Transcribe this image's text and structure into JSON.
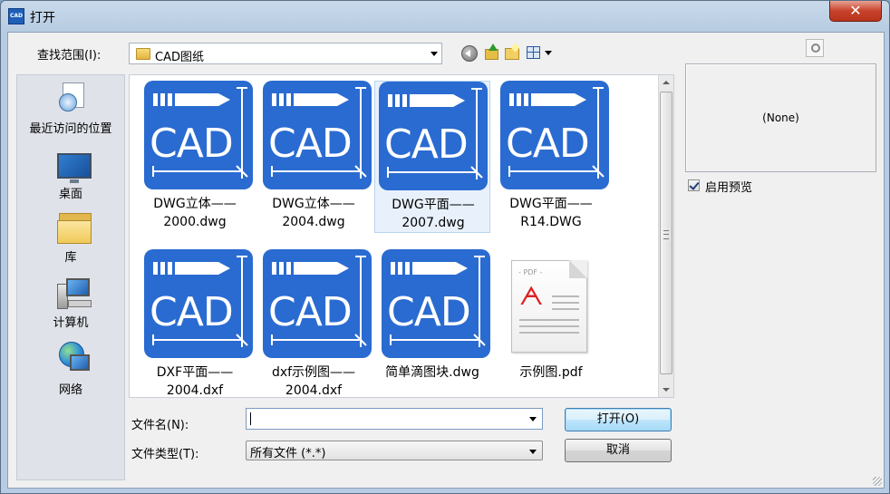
{
  "window": {
    "title": "打开",
    "app_icon_text": "CAD",
    "close_glyph": "✕"
  },
  "lookin": {
    "label": "查找范围(I):",
    "value": "CAD图纸"
  },
  "toolbar": {
    "icons": [
      "back-icon",
      "up-folder-icon",
      "new-folder-icon",
      "view-menu-icon"
    ]
  },
  "places": [
    {
      "label": "最近访问的位置",
      "icon": "recent-places-icon"
    },
    {
      "label": "桌面",
      "icon": "desktop-icon"
    },
    {
      "label": "库",
      "icon": "libraries-icon"
    },
    {
      "label": "计算机",
      "icon": "computer-icon"
    },
    {
      "label": "网络",
      "icon": "network-icon"
    }
  ],
  "files": [
    {
      "line1": "DWG立体——",
      "line2": "2000.dwg",
      "icon_text": "CAD",
      "type": "cad"
    },
    {
      "line1": "DWG立体——",
      "line2": "2004.dwg",
      "icon_text": "CAD",
      "type": "cad"
    },
    {
      "line1": "DWG平面——",
      "line2": "2007.dwg",
      "icon_text": "CAD",
      "type": "cad",
      "selected": true
    },
    {
      "line1": "DWG平面——",
      "line2": "R14.DWG",
      "icon_text": "CAD",
      "type": "cad"
    },
    {
      "line1": "DXF平面——",
      "line2": "2004.dxf",
      "icon_text": "CAD",
      "type": "cad"
    },
    {
      "line1": "dxf示例图——",
      "line2": "2004.dxf",
      "icon_text": "CAD",
      "type": "cad"
    },
    {
      "line1": "简单滴图块.dwg",
      "line2": "",
      "icon_text": "CAD",
      "type": "cad"
    },
    {
      "line1": "示例图.pdf",
      "line2": "",
      "icon_text": "PDF",
      "type": "pdf"
    }
  ],
  "preview": {
    "none_text": "(None)",
    "checkbox_label": "启用预览",
    "checked": true
  },
  "filename": {
    "label": "文件名(N):",
    "value": ""
  },
  "filetype": {
    "label": "文件类型(T):",
    "value": "所有文件 (*.*)"
  },
  "buttons": {
    "open_label": "打开(O)",
    "cancel_label": "取消"
  },
  "colors": {
    "cad_icon": "#2a6bd1",
    "selection": "#e8f1fb",
    "pdf_logo": "#dd2222"
  }
}
